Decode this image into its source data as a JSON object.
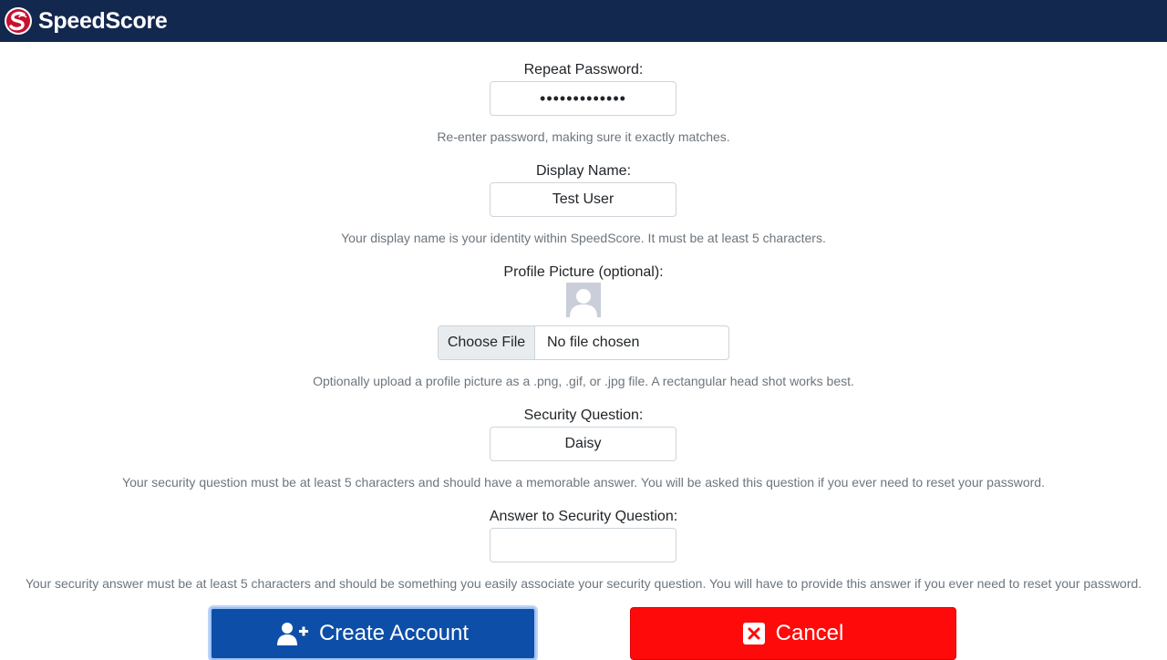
{
  "app": {
    "brand_name": "SpeedScore",
    "logo_icon": "speedscore-logo-icon"
  },
  "form": {
    "repeat_password": {
      "label": "Repeat Password:",
      "value": "•••••••••••••",
      "help": "Re-enter password, making sure it exactly matches."
    },
    "display_name": {
      "label": "Display Name:",
      "value": "Test User",
      "help": "Your display name is your identity within SpeedScore. It must be at least 5 characters."
    },
    "profile_picture": {
      "label": "Profile Picture (optional):",
      "avatar_icon": "default-avatar-icon",
      "choose_button": "Choose File",
      "file_status": "No file chosen",
      "help": "Optionally upload a profile picture as a .png, .gif, or .jpg file. A rectangular head shot works best."
    },
    "security_question": {
      "label": "Security Question:",
      "value": "Daisy",
      "help": "Your security question must be at least 5 characters and should have a memorable answer. You will be asked this question if you ever need to reset your password."
    },
    "security_answer": {
      "label": "Answer to Security Question:",
      "value": "",
      "help": "Your security answer must be at least 5 characters and should be something you easily associate your security question. You will have to provide this answer if you ever need to reset your password."
    }
  },
  "actions": {
    "create_label": "Create Account",
    "create_icon": "user-plus-icon",
    "cancel_label": "Cancel",
    "cancel_icon": "close-square-icon"
  },
  "colors": {
    "navbar": "#13284f",
    "create_button": "#0d4fa8",
    "cancel_button": "#ff0a0a"
  }
}
